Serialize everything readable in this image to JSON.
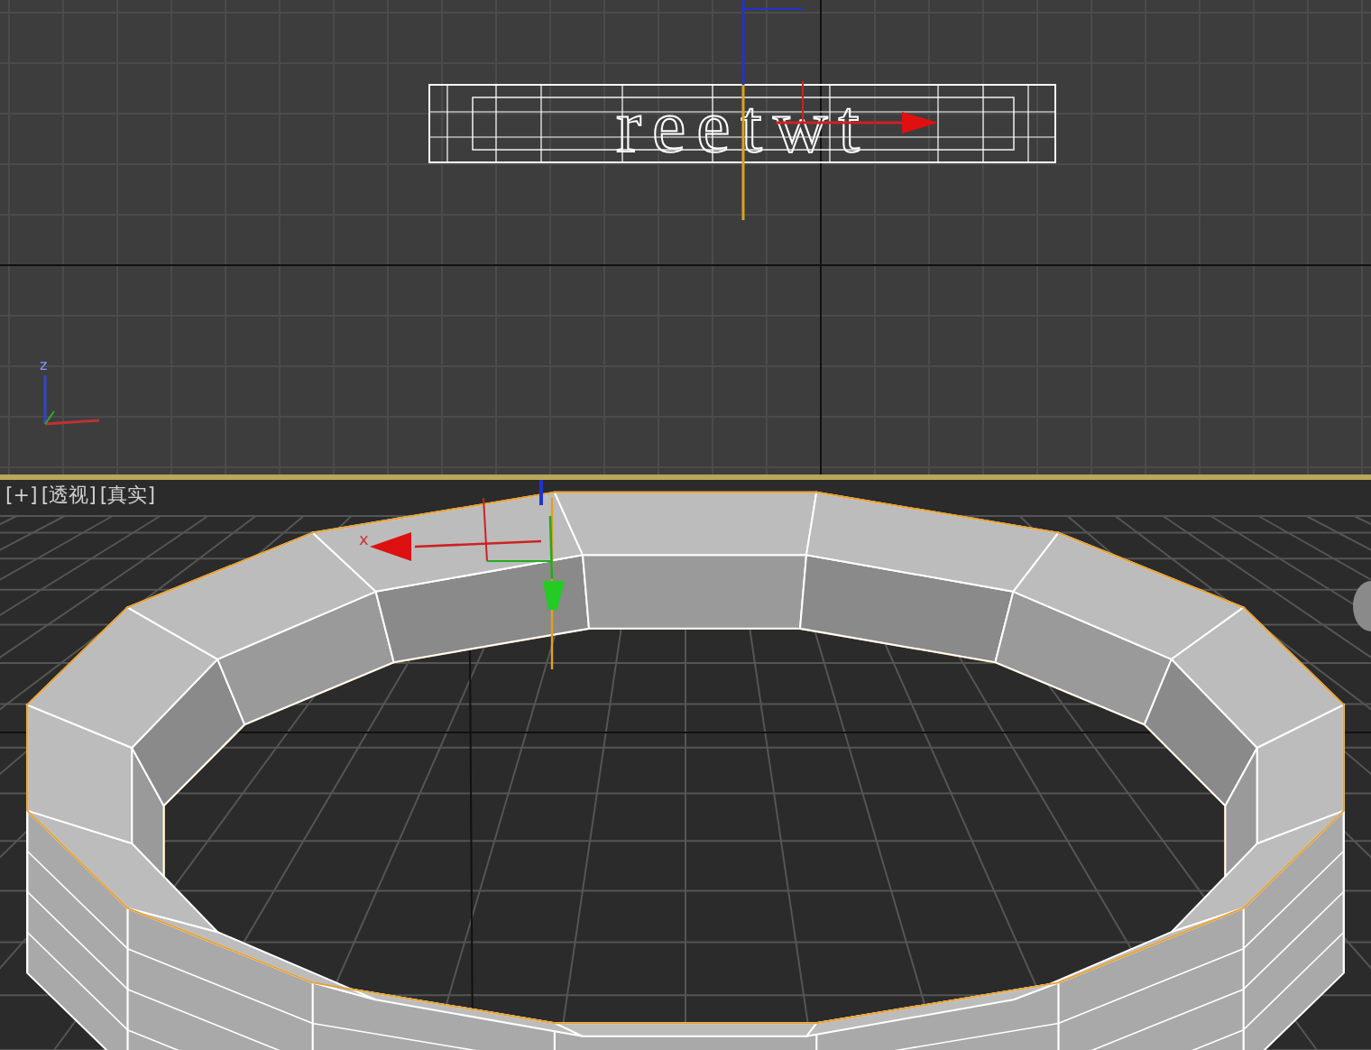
{
  "top_viewport": {
    "text_object": "reetwt",
    "axis_tripod_label": "z"
  },
  "perspective_viewport": {
    "active": true,
    "labels": [
      {
        "text": "[+]"
      },
      {
        "text": "[透视]"
      },
      {
        "text": "[真实]"
      }
    ],
    "gizmo_axis_label": "x"
  }
}
